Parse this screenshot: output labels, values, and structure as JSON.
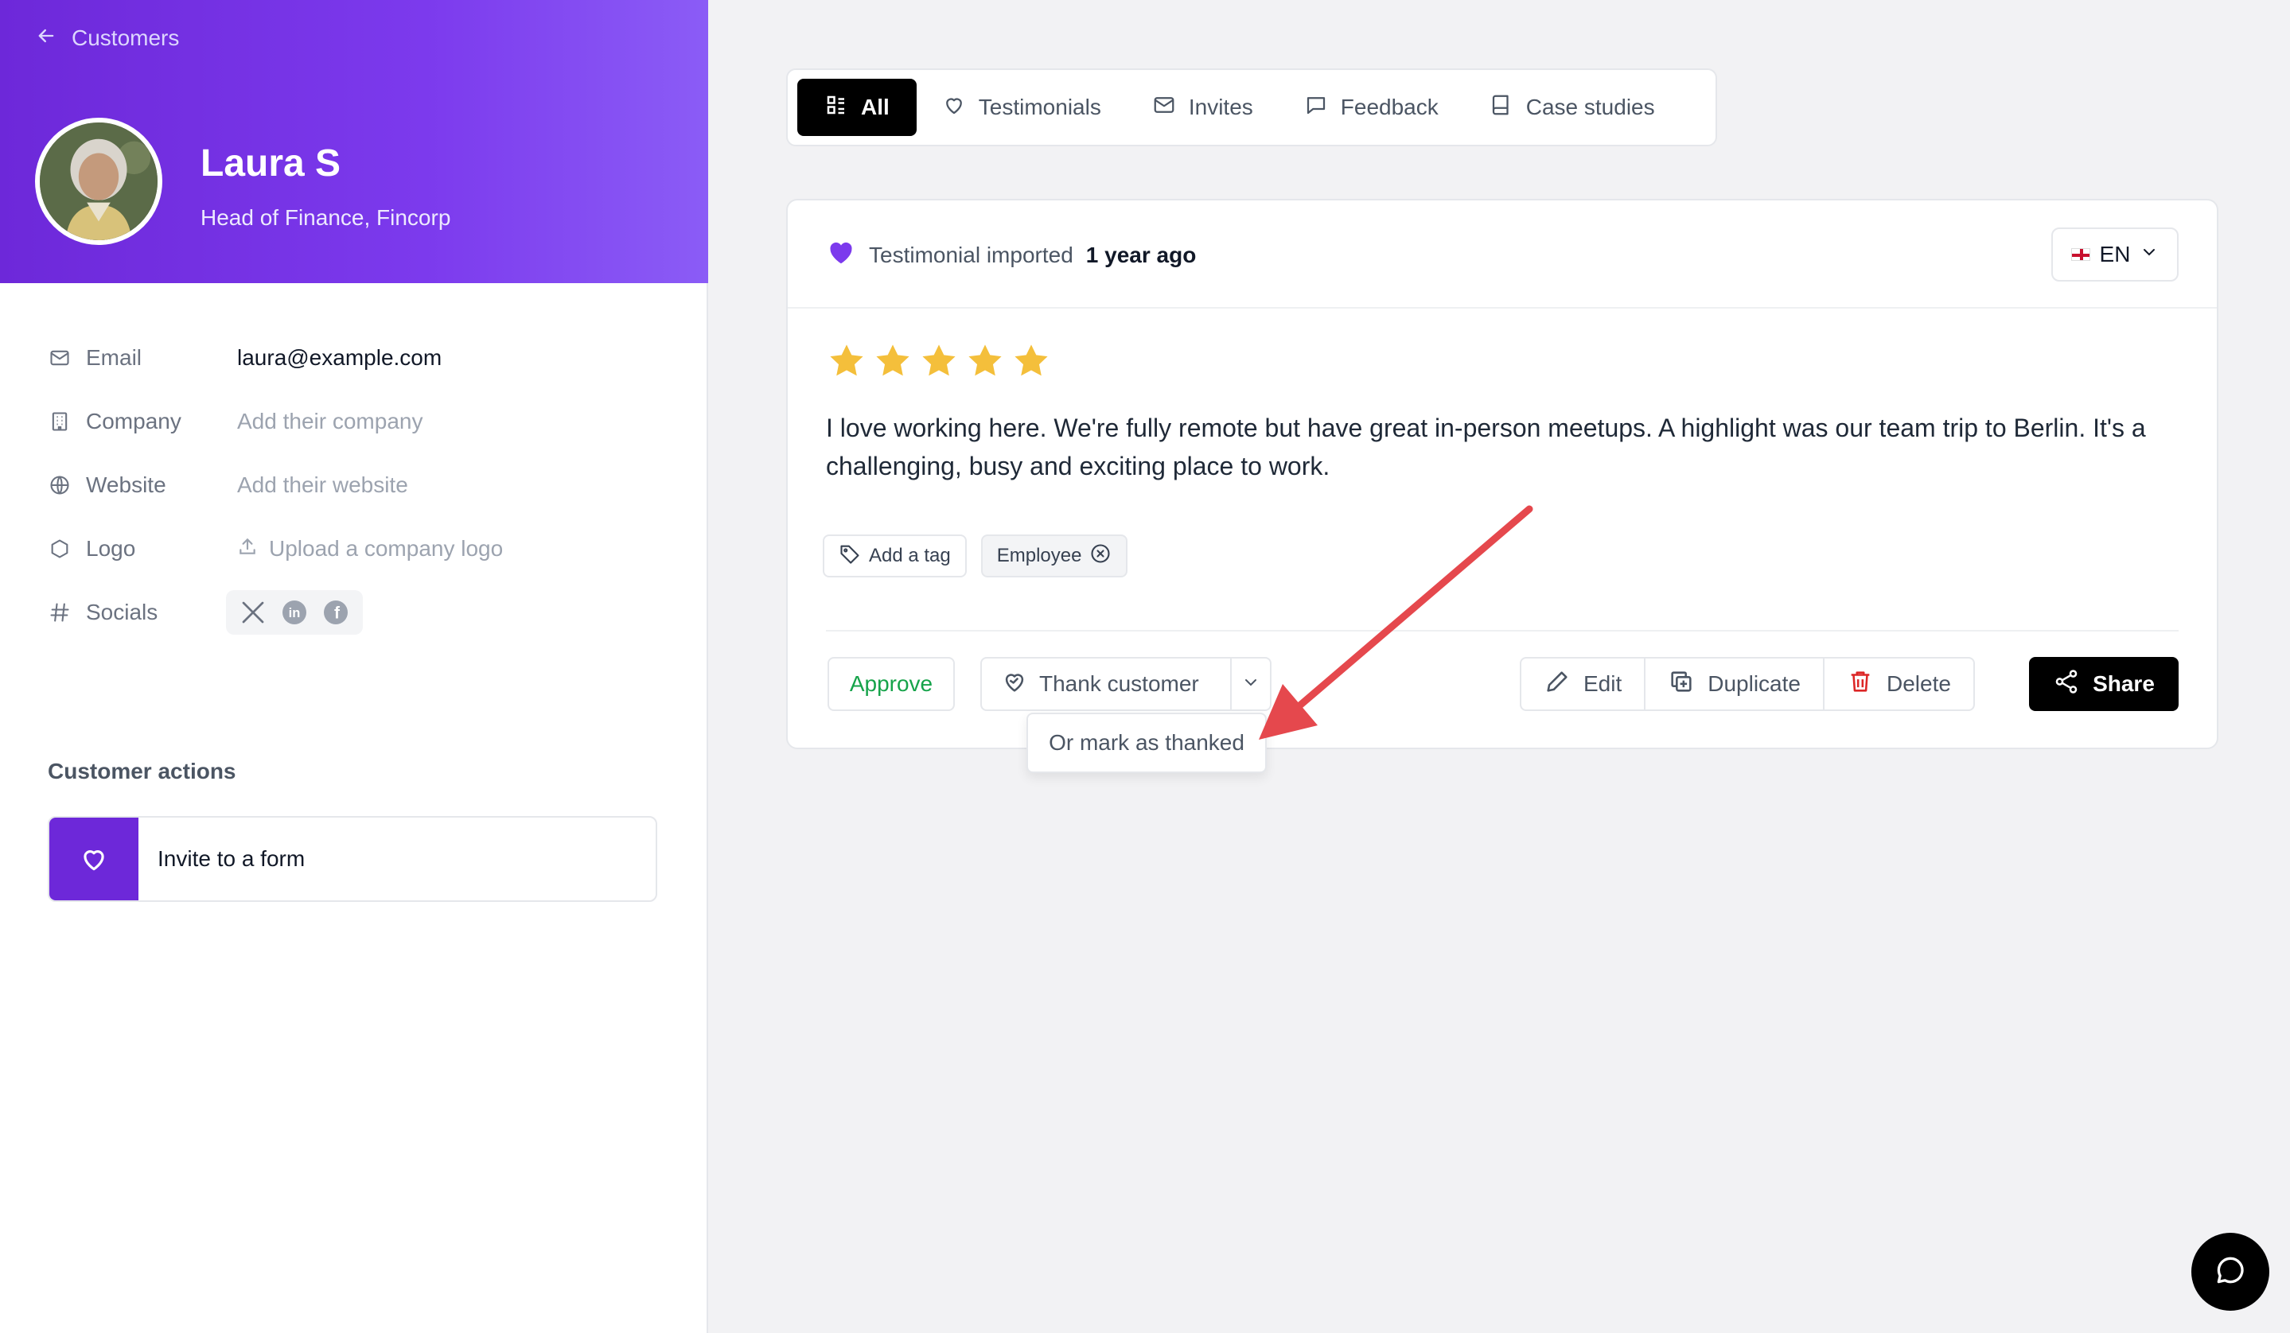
{
  "sidebar": {
    "back_label": "Customers",
    "customer": {
      "name": "Laura S",
      "title": "Head of Finance, Fincorp"
    },
    "fields": {
      "email": {
        "label": "Email",
        "value": "laura@example.com"
      },
      "company": {
        "label": "Company",
        "placeholder": "Add their company"
      },
      "website": {
        "label": "Website",
        "placeholder": "Add their website"
      },
      "logo": {
        "label": "Logo",
        "action": "Upload a company logo"
      },
      "socials": {
        "label": "Socials",
        "icons": [
          "x-icon",
          "linkedin-icon",
          "facebook-icon"
        ]
      }
    },
    "customer_actions": {
      "title": "Customer actions",
      "invite_label": "Invite to a form"
    }
  },
  "tabs": [
    {
      "label": "All",
      "icon": "grid-list-icon",
      "active": true
    },
    {
      "label": "Testimonials",
      "icon": "heart-icon",
      "active": false
    },
    {
      "label": "Invites",
      "icon": "mail-icon",
      "active": false
    },
    {
      "label": "Feedback",
      "icon": "message-icon",
      "active": false
    },
    {
      "label": "Case studies",
      "icon": "book-icon",
      "active": false
    }
  ],
  "testimonial": {
    "status_text": "Testimonial imported",
    "time_ago": "1 year ago",
    "language": "EN",
    "rating": 5,
    "text": "I love working here. We're fully remote but have great in-person meetups. A highlight was our team trip to Berlin. It's a challenging, busy and exciting place to work.",
    "add_tag_label": "Add a tag",
    "tags": [
      "Employee"
    ],
    "actions": {
      "approve": "Approve",
      "thank": "Thank customer",
      "mark_thanked": "Or mark as thanked",
      "edit": "Edit",
      "duplicate": "Duplicate",
      "delete": "Delete",
      "share": "Share"
    }
  },
  "colors": {
    "brand_purple": "#6d28d9",
    "star": "#f4bf3b",
    "approve_green": "#16a34a",
    "delete_red": "#dc2626",
    "annotation_arrow": "#e5484d"
  }
}
